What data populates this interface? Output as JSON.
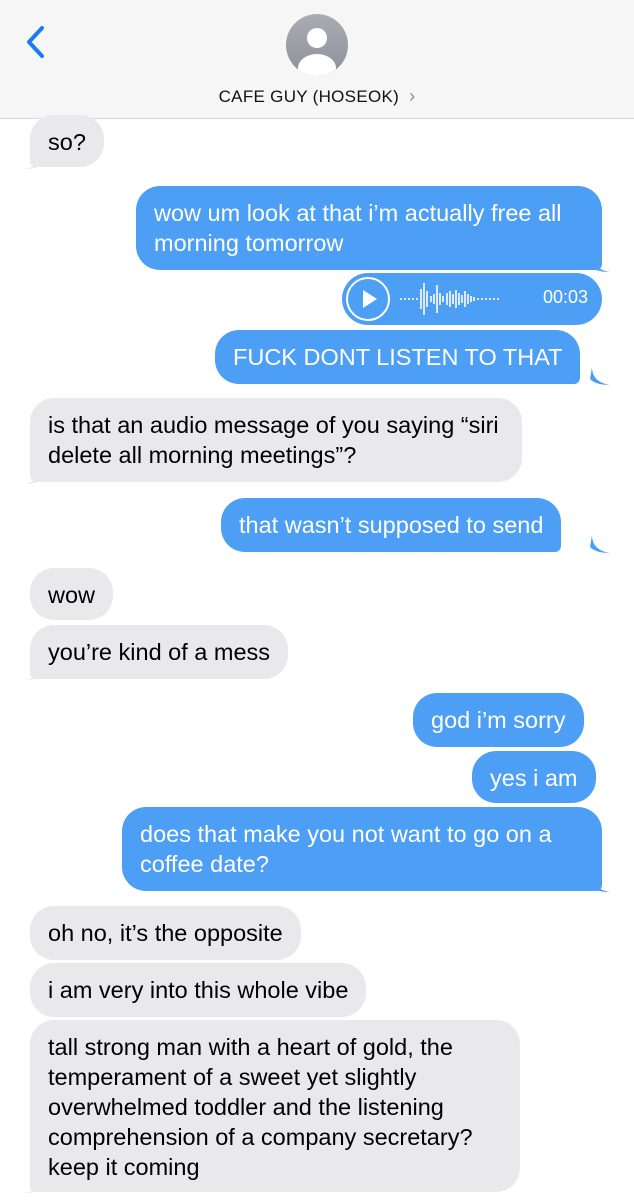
{
  "header": {
    "contact_name": "CAFE GUY (HOSEOK)",
    "chevron": "›"
  },
  "messages": [
    {
      "from": "them",
      "text": "so?"
    },
    {
      "from": "me",
      "text": "wow um look at that i’m actually free all morning tomorrow"
    },
    {
      "from": "me",
      "type": "audio",
      "duration": "00:03"
    },
    {
      "from": "me",
      "text": "FUCK DONT LISTEN TO THAT"
    },
    {
      "from": "them",
      "text": "is that an audio message of you saying “siri delete all morning meetings”?"
    },
    {
      "from": "me",
      "text": "that wasn’t supposed to send"
    },
    {
      "from": "them",
      "text": "wow"
    },
    {
      "from": "them",
      "text": "you’re kind of a mess"
    },
    {
      "from": "me",
      "text": "god i’m sorry"
    },
    {
      "from": "me",
      "text": "yes i am"
    },
    {
      "from": "me",
      "text": "does that make you not want to go on a coffee date?"
    },
    {
      "from": "them",
      "text": "oh no, it’s the opposite"
    },
    {
      "from": "them",
      "text": "i am very into this whole vibe"
    },
    {
      "from": "them",
      "text": "tall strong man with a heart of gold, the temperament of a sweet yet slightly overwhelmed toddler and the listening comprehension of a company secretary? keep it coming"
    }
  ],
  "colors": {
    "outgoing": "#4d9ff5",
    "incoming": "#e9e9eb",
    "accent": "#1a7cf5"
  },
  "icons": {
    "back": "chevron-left-icon",
    "avatar": "person-icon",
    "play": "play-icon"
  }
}
